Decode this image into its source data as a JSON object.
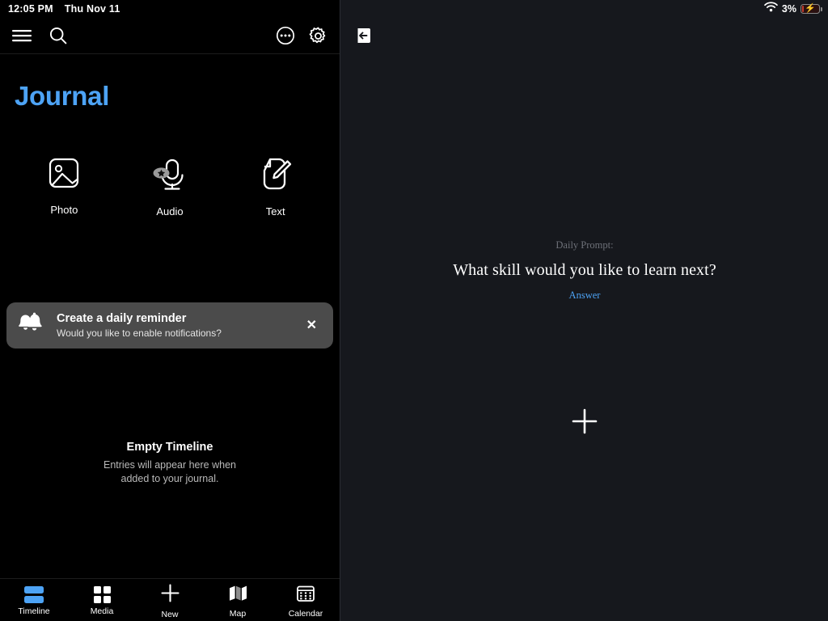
{
  "statusbar": {
    "time": "12:05 PM",
    "date": "Thu Nov 11",
    "battery_percent": "3%",
    "wifi_icon": "wifi-icon",
    "battery_icon": "battery-charging-icon"
  },
  "left_panel": {
    "toolbar": {
      "menu_icon": "hamburger-menu-icon",
      "search_icon": "search-icon",
      "more_icon": "more-options-icon",
      "settings_icon": "gear-icon"
    },
    "title": "Journal",
    "title_color": "#4da3f5",
    "quick_actions": [
      {
        "label": "Photo",
        "icon": "photo-icon"
      },
      {
        "label": "Audio",
        "icon": "microphone-icon"
      },
      {
        "label": "Text",
        "icon": "document-pencil-icon"
      }
    ],
    "banner": {
      "icon": "bell-icon",
      "title": "Create a daily reminder",
      "subtitle": "Would you like to enable notifications?",
      "close_label": "✕",
      "background": "#4b4b4b"
    },
    "empty_state": {
      "title": "Empty Timeline",
      "line1": "Entries will appear here when",
      "line2": "added to your journal."
    },
    "tabs": [
      {
        "label": "Timeline",
        "icon": "timeline-icon",
        "active": true
      },
      {
        "label": "Media",
        "icon": "grid-icon",
        "active": false
      },
      {
        "label": "New",
        "icon": "plus-icon",
        "active": false
      },
      {
        "label": "Map",
        "icon": "map-icon",
        "active": false
      },
      {
        "label": "Calendar",
        "icon": "calendar-icon",
        "active": false
      }
    ]
  },
  "right_panel": {
    "collapse_icon": "collapse-sidebar-icon",
    "prompt_label": "Daily Prompt:",
    "prompt_question": "What skill would you like to learn next?",
    "answer_link": "Answer",
    "add_icon": "plus-icon",
    "background": "#16181d"
  }
}
